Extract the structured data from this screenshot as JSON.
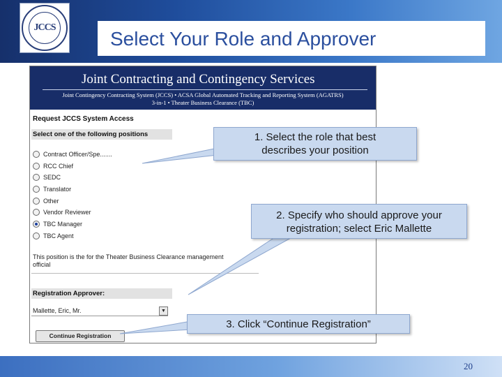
{
  "slide": {
    "title": "Select Your Role and Approver",
    "page_number": "20",
    "logo_text": "JCCS"
  },
  "screenshot": {
    "banner_title": "Joint Contracting and Contingency Services",
    "banner_line_1": "Joint Contingency Contracting System (JCCS)  •  ACSA Global Automated Tracking and Reporting System (AGATRS)",
    "banner_line_2": "3-in-1  •  Theater Business Clearance  (TBC)",
    "request_heading": "Request JCCS System Access",
    "positions_heading": "Select one of the following positions",
    "positions": [
      {
        "label": "Contract Officer/Spe.......",
        "checked": false
      },
      {
        "label": "RCC Chief",
        "checked": false
      },
      {
        "label": "SEDC",
        "checked": false
      },
      {
        "label": "Translator",
        "checked": false
      },
      {
        "label": "Other",
        "checked": false
      },
      {
        "label": "Vendor Reviewer",
        "checked": false
      },
      {
        "label": "TBC Manager",
        "checked": true
      },
      {
        "label": "TBC Agent",
        "checked": false
      }
    ],
    "position_description": "This position is the for the Theater Business Clearance management official",
    "approver_heading": "Registration Approver:",
    "approver_value": "Mallette, Eric, Mr.",
    "approver_arrow": "▼",
    "continue_button": "Continue Registration"
  },
  "callouts": {
    "step1_line1": "1. Select the role that best",
    "step1_line2": "describes your position",
    "step2_line1": "2. Specify who should approve your",
    "step2_line2": "registration; select Eric Mallette",
    "step3": "3. Click “Continue Registration”"
  },
  "colors": {
    "header_dark": "#16306b",
    "title_blue": "#2b4f9e",
    "banner_navy": "#182d68",
    "callout_fill": "#c9d9ef",
    "radio_checked": "#1a3e9c"
  }
}
